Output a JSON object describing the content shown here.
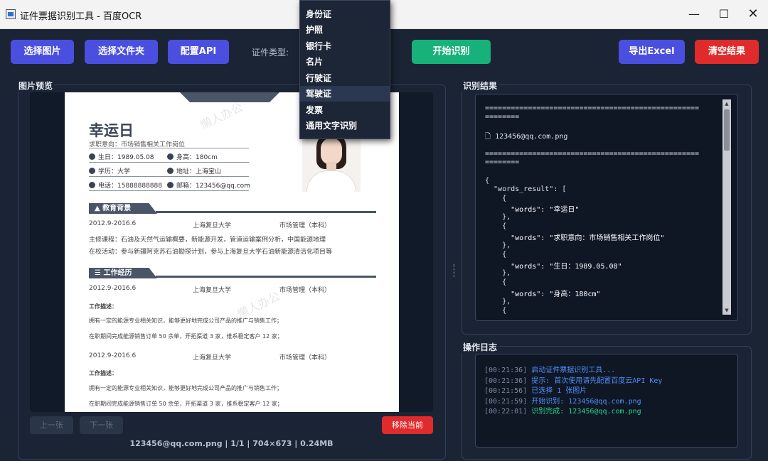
{
  "window": {
    "title": "证件票据识别工具 - 百度OCR",
    "minimize": "—",
    "maximize": "☐",
    "close": "✕"
  },
  "toolbar": {
    "select_image": "选择图片",
    "select_folder": "选择文件夹",
    "config_api": "配置API",
    "cert_type_label": "证件类型:",
    "start": "开始识别",
    "export_excel": "导出Excel",
    "clear": "清空结果"
  },
  "cert_type_dropdown": {
    "options": [
      "身份证",
      "护照",
      "银行卡",
      "名片",
      "行驶证",
      "驾驶证",
      "发票",
      "通用文字识别"
    ],
    "highlighted": "驾驶证"
  },
  "preview": {
    "title": "图片预览",
    "prev": "上一张",
    "next": "下一张",
    "remove": "移除当前",
    "file_info": "123456@qq.com.png | 1/1 | 704×673 | 0.24MB"
  },
  "resume": {
    "watermark": "懒人办公",
    "name": "幸运日",
    "intent": "求职意向：市场销售相关工作岗位",
    "birth": "生日：1989.05.08",
    "height": "身高：180cm",
    "education": "学历：大学",
    "address": "地址：上海宝山",
    "phone": "电话：15888888888",
    "email": "邮箱：123456@qq.com",
    "edu_section": "教育背景",
    "edu_period": "2012.9-2016.6",
    "edu_school": "上海复旦大学",
    "edu_major": "市场管理（本科）",
    "edu_courses": "主修课程：石油及天然气运输概要，新能源开发，管道运输案例分析，中国能源地理",
    "edu_activities": "在校活动：参与新疆阿克苏石油勘探计划，参与上海复旦大学石油新能源清洁化项目等",
    "work_section": "工作经历",
    "job1_period": "2012.9-2016.6",
    "job1_company": "上海复旦大学",
    "job1_role": "市场管理（本科）",
    "job_desc_label": "工作描述：",
    "job_desc1": "拥有一定的能源专业相关知识，能够更好地完成公司产品的推广与销售工作；",
    "job_desc2": "在职期间完成能源销售订单 50 余单，开拓渠道 3 家，维系稳定客户 12 家；",
    "job2_period": "2012.9-2016.6",
    "job2_company": "上海复旦大学",
    "job2_role": "市场管理（本科）"
  },
  "result": {
    "title": "识别结果",
    "separator": "==================================================",
    "separator_tail": "========",
    "file_name": "123456@qq.com.png",
    "json_open": "{",
    "words_key": "  \"words_result\": [",
    "obj_open": "    {",
    "obj_close": "    },",
    "word1": "      \"words\": \"幸运日\"",
    "word2": "      \"words\": \"求职意向：市场销售相关工作岗位\"",
    "word3": "      \"words\": \"生日：1989.05.08\"",
    "word4": "      \"words\": \"身高：180cm\""
  },
  "log": {
    "title": "操作日志",
    "entries": [
      {
        "time": "[00:21:36]",
        "text": "启动证件票据识别工具...",
        "color": "#4f8ff7"
      },
      {
        "time": "[00:21:36]",
        "text": "提示: 首次使用请先配置百度云API Key",
        "color": "#4f8ff7"
      },
      {
        "time": "[00:21:56]",
        "text": "已选择 1 张图片",
        "color": "#4f8ff7"
      },
      {
        "time": "[00:21:59]",
        "text": "开始识别: 123456@qq.com.png",
        "color": "#4f8ff7"
      },
      {
        "time": "[00:22:01]",
        "text": "识别完成: 123456@qq.com.png",
        "color": "#2bd48a"
      }
    ]
  },
  "colors": {
    "background": "#1b2434",
    "primary": "#4a4fe0",
    "success": "#16b27a",
    "danger": "#df2b2b"
  }
}
